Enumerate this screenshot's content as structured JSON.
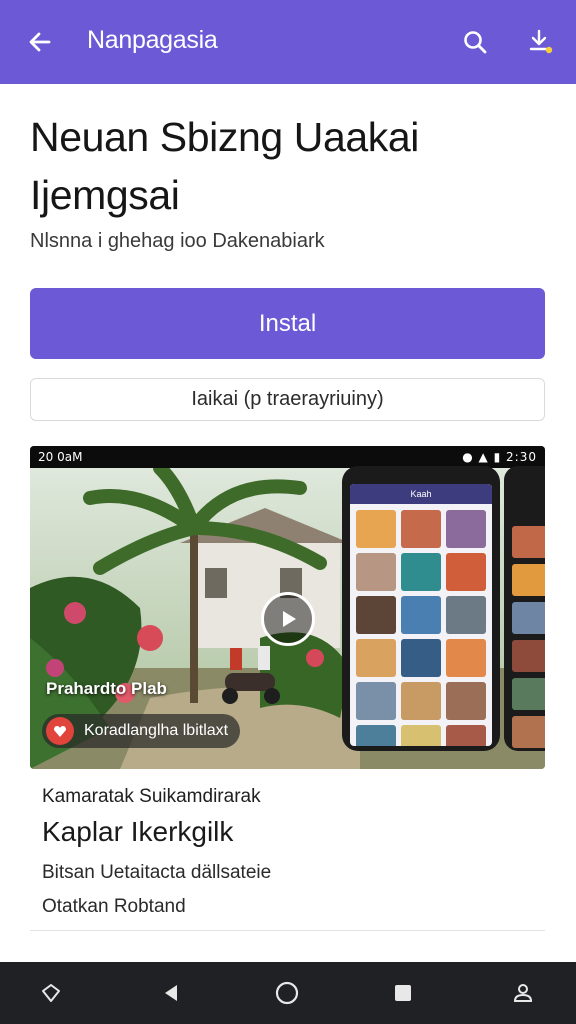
{
  "app_bar": {
    "title": "Nanpagasia",
    "background": "#6b59d6",
    "back_icon": "arrow-left-icon",
    "search_icon": "search-icon",
    "download_icon": "download-icon"
  },
  "app": {
    "title": "Neuan Sbizng Uaakai Ijemgsai",
    "developer": "Nlsnna i ghehag ioo Dakenabiark"
  },
  "actions": {
    "install_label": "Instal",
    "secondary_label": "Iaikai (p traerayriuiny)",
    "accent": "#6b59d6"
  },
  "video": {
    "status_time": "20 0aM",
    "status_right": "2:30",
    "play_label": "Prahardto Plab",
    "chip_label": "Koradlanglha lbitlaxt",
    "phone_header": "Kaah"
  },
  "details": {
    "small_line": "Kamaratak Suikamdirarak",
    "heading": "Kaplar Ikerkgilk",
    "line1": "Bitsan Uetaitacta dällsateie",
    "line2": "Otatkan Robtand"
  },
  "nav_bar": {
    "icons": [
      "diamond-icon",
      "back-triangle-icon",
      "home-circle-icon",
      "recents-square-icon",
      "account-icon"
    ]
  }
}
